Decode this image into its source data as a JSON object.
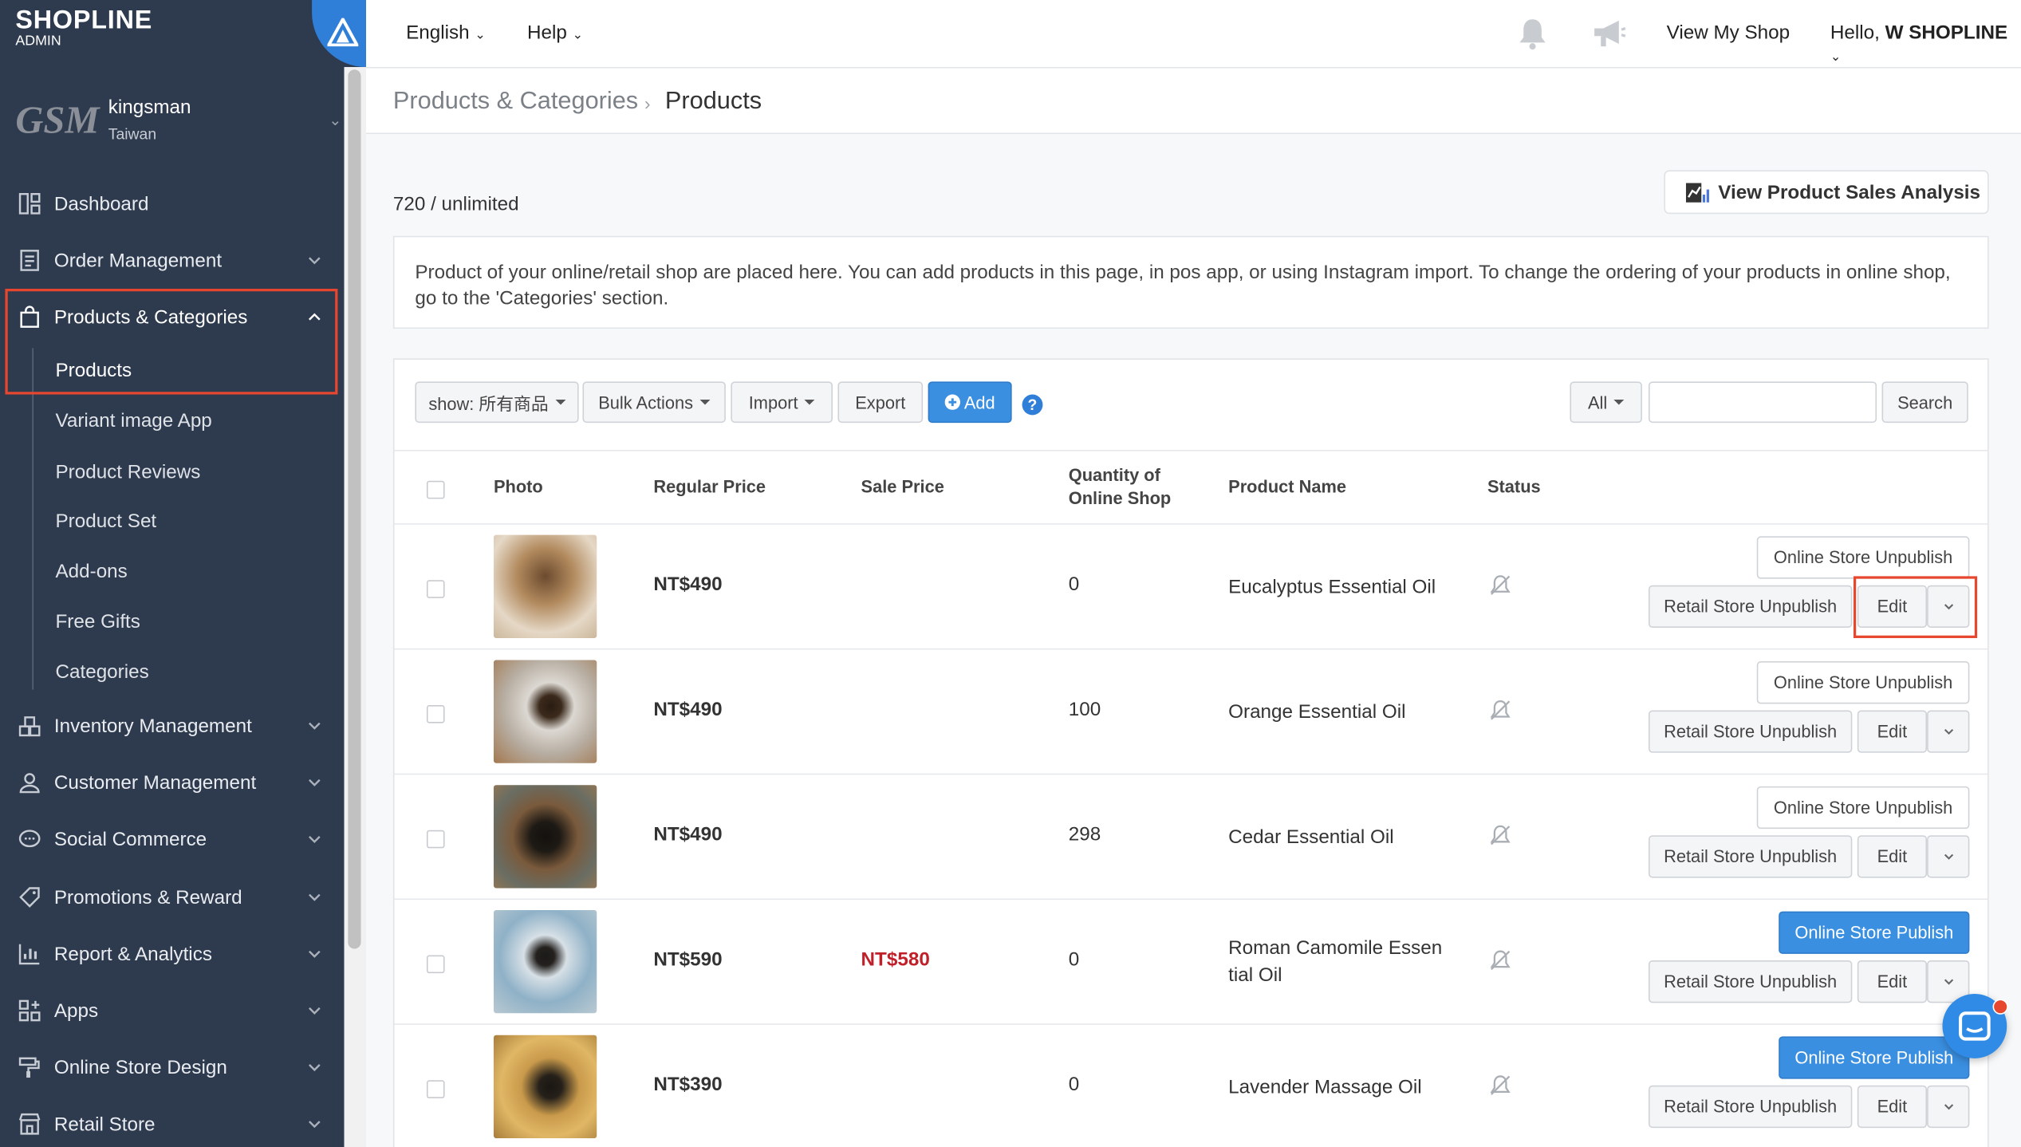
{
  "brand": {
    "top": "SHOPLINE",
    "sub": "ADMIN"
  },
  "account": {
    "logo": "GSM",
    "name": "kingsman",
    "region": "Taiwan"
  },
  "topbar": {
    "language": "English",
    "help": "Help",
    "view_shop": "View My Shop",
    "greeting": "Hello, ",
    "user": "W SHOPLINE"
  },
  "sidebar": {
    "items": [
      {
        "label": "Dashboard"
      },
      {
        "label": "Order Management"
      },
      {
        "label": "Products & Categories"
      },
      {
        "label": "Inventory Management"
      },
      {
        "label": "Customer Management"
      },
      {
        "label": "Social Commerce"
      },
      {
        "label": "Promotions & Reward"
      },
      {
        "label": "Report & Analytics"
      },
      {
        "label": "Apps"
      },
      {
        "label": "Online Store Design"
      },
      {
        "label": "Retail Store"
      }
    ],
    "sub_items": [
      {
        "label": "Products"
      },
      {
        "label": "Variant image App"
      },
      {
        "label": "Product Reviews"
      },
      {
        "label": "Product Set"
      },
      {
        "label": "Add-ons"
      },
      {
        "label": "Free Gifts"
      },
      {
        "label": "Categories"
      }
    ]
  },
  "breadcrumb": {
    "parent": "Products & Categories",
    "current": "Products"
  },
  "summary": {
    "count": "720 / unlimited",
    "analysis_button": "View Product Sales Analysis"
  },
  "notice": "Product of your online/retail shop are placed here. You can add products in this page, in pos app, or using Instagram import. To change the ordering of your products in online shop, go to the 'Categories' section.",
  "toolbar": {
    "show": "show: 所有商品",
    "bulk": "Bulk Actions",
    "import": "Import",
    "export": "Export",
    "add": "Add",
    "filter": "All",
    "search": "Search"
  },
  "table": {
    "headers": {
      "photo": "Photo",
      "regular_price": "Regular Price",
      "sale_price": "Sale Price",
      "quantity_line1": "Quantity of",
      "quantity_line2": "Online Shop",
      "name": "Product Name",
      "status": "Status"
    },
    "rows": [
      {
        "regular_price": "NT$490",
        "sale_price": "",
        "quantity": "0",
        "name": "Eucalyptus Essential Oil",
        "online_action": "Online Store Unpublish",
        "retail_action": "Retail Store Unpublish",
        "edit": "Edit"
      },
      {
        "regular_price": "NT$490",
        "sale_price": "",
        "quantity": "100",
        "name": "Orange Essential Oil",
        "online_action": "Online Store Unpublish",
        "retail_action": "Retail Store Unpublish",
        "edit": "Edit"
      },
      {
        "regular_price": "NT$490",
        "sale_price": "",
        "quantity": "298",
        "name": "Cedar Essential Oil",
        "online_action": "Online Store Unpublish",
        "retail_action": "Retail Store Unpublish",
        "edit": "Edit"
      },
      {
        "regular_price": "NT$590",
        "sale_price": "NT$580",
        "quantity": "0",
        "name": "Roman Camomile Essen tial Oil",
        "online_action": "Online Store Publish",
        "retail_action": "Retail Store Unpublish",
        "edit": "Edit"
      },
      {
        "regular_price": "NT$390",
        "sale_price": "",
        "quantity": "0",
        "name": "Lavender Massage Oil",
        "online_action": "Online Store Publish",
        "retail_action": "Retail Store Unpublish",
        "edit": "Edit"
      }
    ]
  },
  "colors": {
    "sidebar_bg": "#2e3a4e",
    "accent_blue": "#3a8fe0",
    "highlight_red": "#e8472f",
    "sale_red": "#c0202a"
  }
}
